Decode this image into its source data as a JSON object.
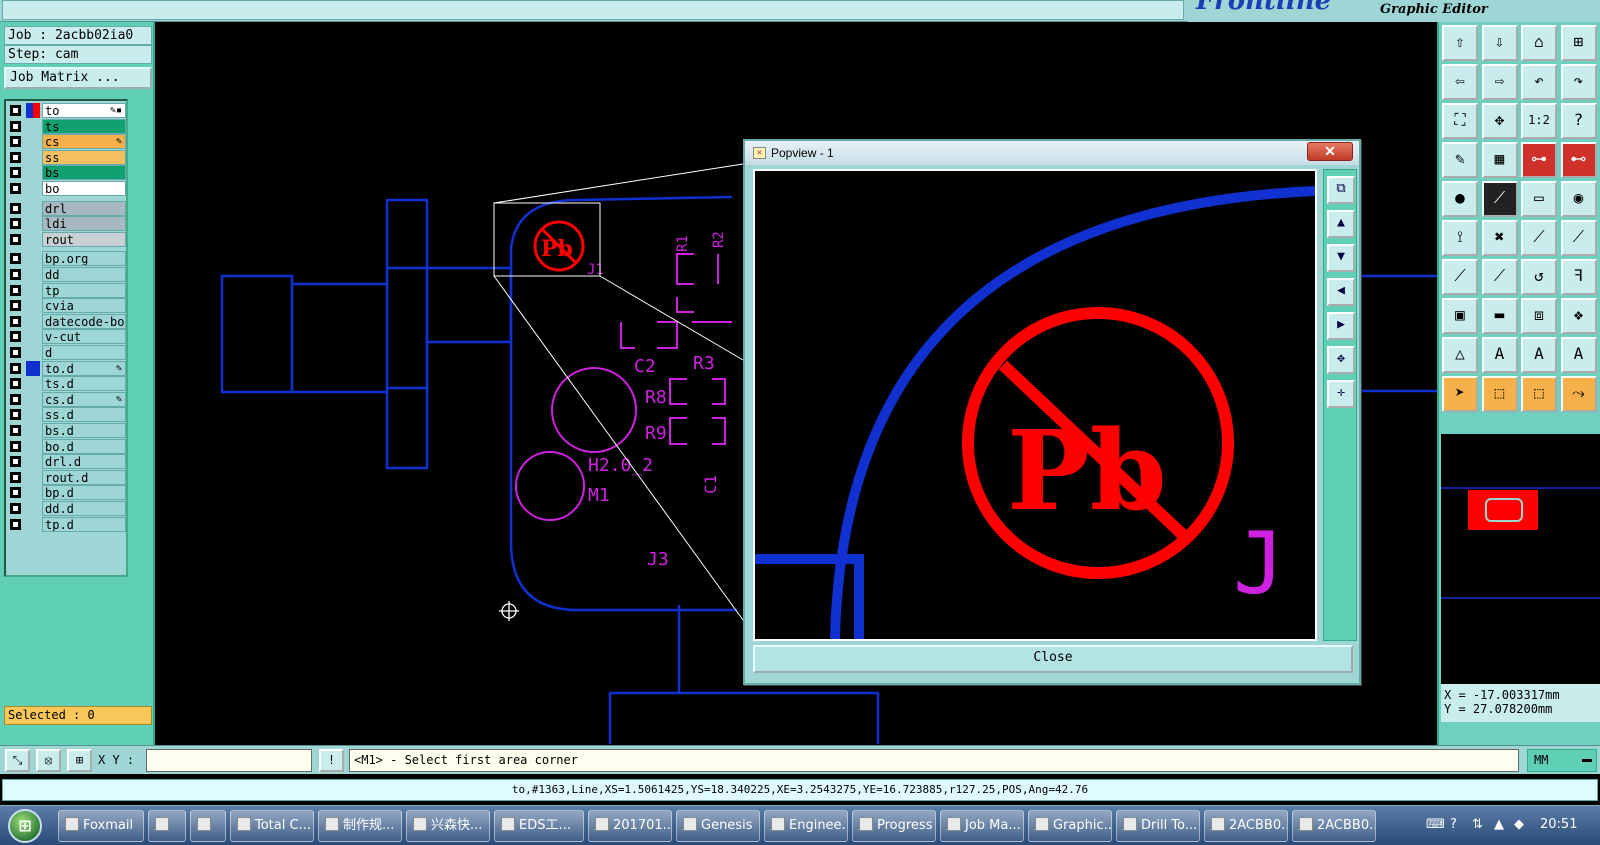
{
  "app": {
    "name": "Frontline",
    "subtitle": "Graphic Editor"
  },
  "job": {
    "job_label": "Job : 2acbb02ia0",
    "step_label": "Step: cam",
    "matrix_button": "Job Matrix ..."
  },
  "layers": [
    {
      "name": "to",
      "color": "#ffffff",
      "swatch": "#1030d0",
      "mark": "✎▪"
    },
    {
      "name": "ts",
      "color": "#10a070",
      "swatch": "",
      "mark": ""
    },
    {
      "name": "cs",
      "color": "#f5b04a",
      "swatch": "",
      "mark": "✎"
    },
    {
      "name": "ss",
      "color": "#f5c060",
      "swatch": "",
      "mark": ""
    },
    {
      "name": "bs",
      "color": "#10a070",
      "swatch": "",
      "mark": ""
    },
    {
      "name": "bo",
      "color": "#ffffff",
      "swatch": "",
      "mark": ""
    },
    {
      "name": "drl",
      "color": "#a8b8c0",
      "swatch": "",
      "mark": ""
    },
    {
      "name": "ldi",
      "color": "#a8b8c0",
      "swatch": "",
      "mark": ""
    },
    {
      "name": "rout",
      "color": "#c8d0d4",
      "swatch": "",
      "mark": ""
    },
    {
      "name": "bp.org",
      "color": "#9ed6d6",
      "swatch": "",
      "mark": ""
    },
    {
      "name": "dd",
      "color": "#9ed6d6",
      "swatch": "",
      "mark": ""
    },
    {
      "name": "tp",
      "color": "#9ed6d6",
      "swatch": "",
      "mark": ""
    },
    {
      "name": "cvia",
      "color": "#9ed6d6",
      "swatch": "",
      "mark": ""
    },
    {
      "name": "datecode-bo",
      "color": "#9ed6d6",
      "swatch": "",
      "mark": ""
    },
    {
      "name": "v-cut",
      "color": "#9ed6d6",
      "swatch": "",
      "mark": ""
    },
    {
      "name": "d",
      "color": "#9ed6d6",
      "swatch": "",
      "mark": ""
    },
    {
      "name": "to.d",
      "color": "#9ed6d6",
      "swatch": "#1030d0",
      "mark": "✎"
    },
    {
      "name": "ts.d",
      "color": "#9ed6d6",
      "swatch": "",
      "mark": ""
    },
    {
      "name": "cs.d",
      "color": "#9ed6d6",
      "swatch": "",
      "mark": "✎"
    },
    {
      "name": "ss.d",
      "color": "#9ed6d6",
      "swatch": "",
      "mark": ""
    },
    {
      "name": "bs.d",
      "color": "#9ed6d6",
      "swatch": "",
      "mark": ""
    },
    {
      "name": "bo.d",
      "color": "#9ed6d6",
      "swatch": "",
      "mark": ""
    },
    {
      "name": "drl.d",
      "color": "#9ed6d6",
      "swatch": "",
      "mark": ""
    },
    {
      "name": "rout.d",
      "color": "#9ed6d6",
      "swatch": "",
      "mark": ""
    },
    {
      "name": "bp.d",
      "color": "#9ed6d6",
      "swatch": "",
      "mark": ""
    },
    {
      "name": "dd.d",
      "color": "#9ed6d6",
      "swatch": "",
      "mark": ""
    },
    {
      "name": "tp.d",
      "color": "#9ed6d6",
      "swatch": "",
      "mark": ""
    }
  ],
  "selected_label": "Selected : 0",
  "canvas_labels": {
    "r1": "R1",
    "r2": "R2",
    "c2": "C2",
    "r3": "R3",
    "r8": "R8",
    "r9": "R9",
    "h2": "H2.0_2",
    "m1": "M1",
    "c1": "C1",
    "j3": "J3",
    "j1": "J1",
    "pb": "Pb"
  },
  "popview": {
    "title": "Popview - 1",
    "close_x": "✕",
    "close_button": "Close",
    "j_label": "J",
    "pb": "Pb"
  },
  "coords": {
    "x": "X = -17.003317mm",
    "y": "Y = 27.078200mm"
  },
  "command": {
    "xy_label": "X Y :",
    "xy_value": "",
    "prompt": "<M1> - Select first area corner",
    "units": "MM"
  },
  "status_line": "to,#1363,Line,XS=1.5061425,YS=18.340225,XE=3.2543275,YE=16.723885,r127.25,POS,Ang=42.76",
  "taskbar": {
    "items": [
      "Foxmail",
      "",
      "",
      "Total C...",
      "制作规...",
      "兴森快...",
      "EDS工...",
      "201701...",
      "Genesis",
      "Enginee...",
      "Progress",
      "Job Ma...",
      "Graphic...",
      "Drill To...",
      "2ACBB0...",
      "2ACBB0..."
    ],
    "clock": "20:51"
  },
  "colors": {
    "accent_teal": "#9ed6d6",
    "panel_green": "#5fcfb5",
    "layer_blue": "#1030d0",
    "silk_magenta": "#d020e0",
    "pb_red": "#ff0000"
  }
}
